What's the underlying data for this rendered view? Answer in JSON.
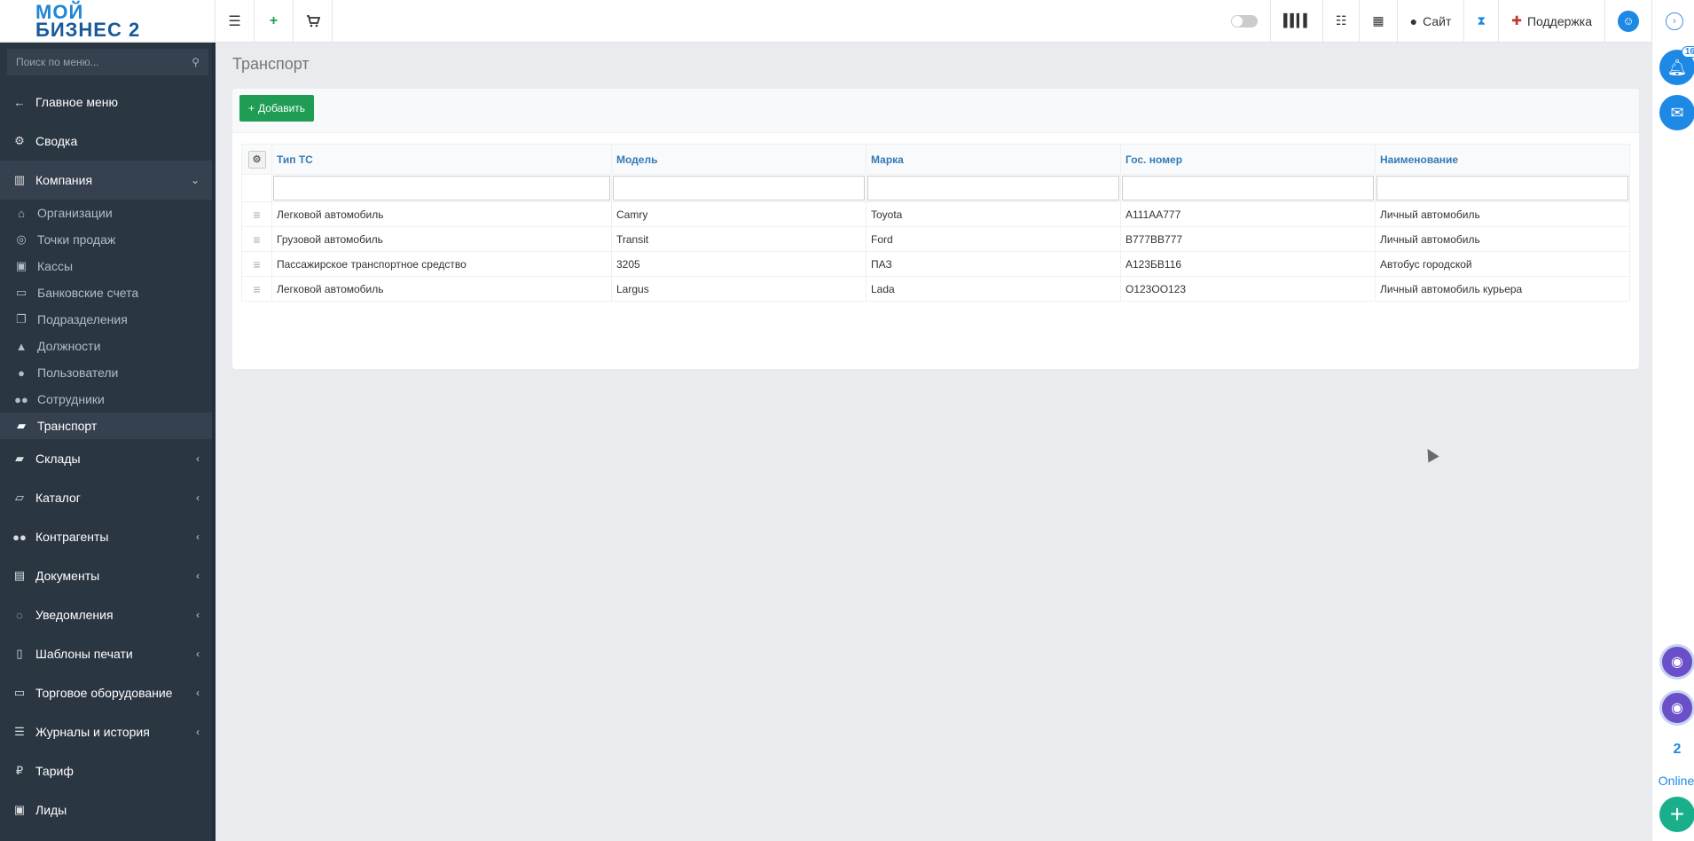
{
  "logo": {
    "line1": "МОЙ",
    "line2": "БИЗНЕС 2"
  },
  "topbar": {
    "site_label": "Сайт",
    "support_label": "Поддержка"
  },
  "sidebar": {
    "search_placeholder": "Поиск по меню...",
    "items": [
      {
        "label": "Главное меню",
        "icon": "arrow-left-icon"
      },
      {
        "label": "Сводка",
        "icon": "gear-icon"
      },
      {
        "label": "Компания",
        "icon": "bar-chart-icon"
      },
      {
        "label": "Склады",
        "icon": "truck-icon"
      },
      {
        "label": "Каталог",
        "icon": "folder-icon"
      },
      {
        "label": "Контрагенты",
        "icon": "users-icon"
      },
      {
        "label": "Документы",
        "icon": "document-icon"
      },
      {
        "label": "Уведомления",
        "icon": "chat-icon"
      },
      {
        "label": "Шаблоны печати",
        "icon": "file-icon"
      },
      {
        "label": "Торговое оборудование",
        "icon": "inbox-icon"
      },
      {
        "label": "Журналы и история",
        "icon": "list-icon"
      },
      {
        "label": "Тариф",
        "icon": "ruble-icon"
      },
      {
        "label": "Лиды",
        "icon": "contact-icon"
      }
    ],
    "company_sub": [
      {
        "label": "Организации",
        "icon": "bank-icon"
      },
      {
        "label": "Точки продаж",
        "icon": "target-icon"
      },
      {
        "label": "Кассы",
        "icon": "cash-icon"
      },
      {
        "label": "Банковские счета",
        "icon": "card-icon"
      },
      {
        "label": "Подразделения",
        "icon": "copy-icon"
      },
      {
        "label": "Должности",
        "icon": "graduation-cap-icon"
      },
      {
        "label": "Пользователи",
        "icon": "user-icon"
      },
      {
        "label": "Сотрудники",
        "icon": "group-icon"
      },
      {
        "label": "Транспорт",
        "icon": "car-icon"
      }
    ]
  },
  "page": {
    "title": "Транспорт",
    "add_button": "Добавить"
  },
  "table": {
    "columns": [
      "Тип ТС",
      "Модель",
      "Марка",
      "Гос. номер",
      "Наименование"
    ],
    "rows": [
      [
        "Легковой автомобиль",
        "Camry",
        "Toyota",
        "А111АА777",
        "Личный автомобиль"
      ],
      [
        "Грузовой автомобиль",
        "Transit",
        "Ford",
        "В777ВВ777",
        "Личный автомобиль"
      ],
      [
        "Пассажирское транспортное средство",
        "3205",
        "ПАЗ",
        "А123БВ116",
        "Автобус городской"
      ],
      [
        "Легковой автомобиль",
        "Largus",
        "Lada",
        "О123ОО123",
        "Личный автомобиль курьера"
      ]
    ]
  },
  "rail": {
    "notification_count": "16",
    "online_count": "2",
    "online_label": "Online"
  },
  "colors": {
    "sidebar_bg": "#2b3643",
    "accent_blue": "#337ab7",
    "add_green": "#1f9d55"
  }
}
